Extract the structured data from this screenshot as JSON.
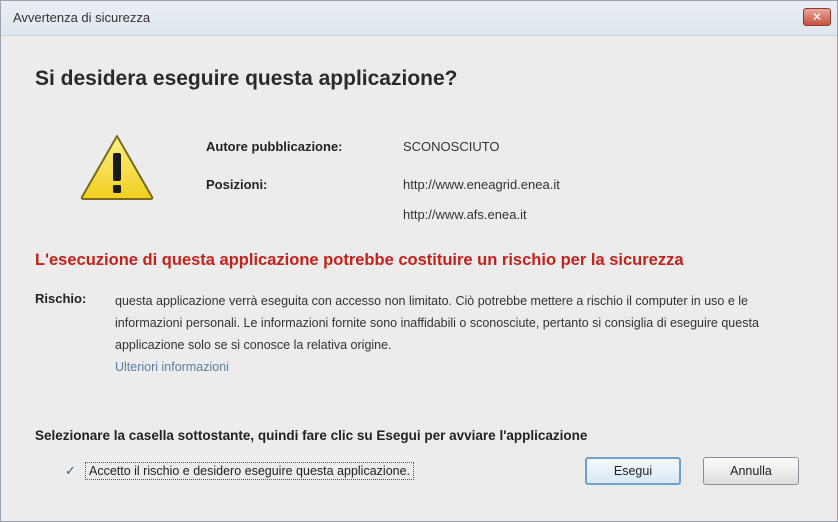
{
  "window": {
    "title": "Avvertenza di sicurezza",
    "close_label": "✕"
  },
  "heading": "Si desidera eseguire questa applicazione?",
  "icon": "warning-icon",
  "details": {
    "publisher_label": "Autore pubblicazione:",
    "publisher_value": "SCONOSCIUTO",
    "locations_label": "Posizioni:",
    "locations": [
      "http://www.eneagrid.enea.it",
      "http://www.afs.enea.it"
    ]
  },
  "warning_text": "L'esecuzione di questa applicazione potrebbe costituire un rischio per la sicurezza",
  "risk": {
    "label": "Rischio:",
    "text": "questa applicazione verrà eseguita con accesso non limitato. Ciò potrebbe mettere a rischio il computer in uso e le informazioni personali. Le informazioni fornite sono inaffidabili o sconosciute, pertanto si consiglia di eseguire questa applicazione solo se si conosce la relativa origine.",
    "more_info": "Ulteriori informazioni"
  },
  "instruction": "Selezionare la casella sottostante, quindi fare clic su Esegui per avviare l'applicazione",
  "accept_checkbox": {
    "checked": true,
    "label": "Accetto il rischio e desidero eseguire questa applicazione."
  },
  "buttons": {
    "run": "Esegui",
    "cancel": "Annulla"
  },
  "colors": {
    "warning_red": "#c6201a",
    "link": "#5a7fa6",
    "icon_yellow": "#f6dd3c"
  }
}
